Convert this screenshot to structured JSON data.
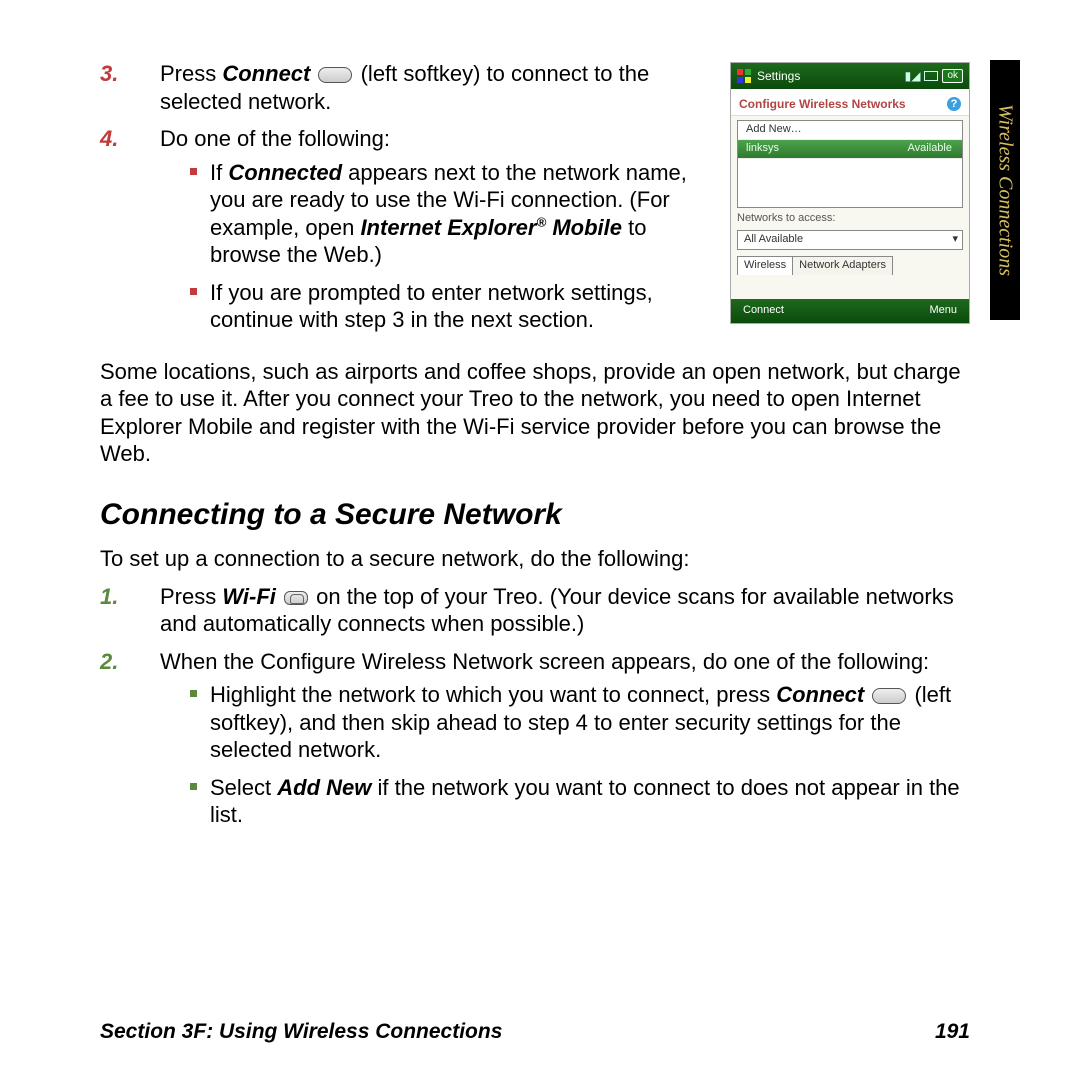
{
  "side_tab": "Wireless Connections",
  "step3": {
    "num": "3.",
    "pre": "Press ",
    "connect": "Connect",
    "post": " (left softkey) to connect to the selected network."
  },
  "step4": {
    "num": "4.",
    "text": "Do one of the following:",
    "bullets": {
      "b1": {
        "a": "If ",
        "b": "Connected",
        "c": " appears next to the network name, you are ready to use the Wi-Fi connection. (For example, open ",
        "d": "Internet Explorer",
        "reg": "®",
        "e": " Mobile",
        "f": " to browse the Web.)"
      },
      "b2": "If you are prompted to enter network settings, continue with step 3 in the next section."
    }
  },
  "below_para": "Some locations, such as airports and coffee shops, provide an open network, but charge a fee to use it. After you connect your Treo to the network, you need to open Internet Explorer Mobile and register with the Wi-Fi service provider before you can browse the Web.",
  "heading": "Connecting to a Secure Network",
  "intro": "To set up a connection to a secure network, do the following:",
  "sec_step1": {
    "num": "1.",
    "a": "Press ",
    "b": "Wi-Fi",
    "c": " on the top of your Treo. (Your device scans for available networks and automatically connects when possible.)"
  },
  "sec_step2": {
    "num": "2.",
    "text": "When the Configure Wireless Network screen appears, do one of the following:",
    "bullets": {
      "b1": {
        "a": "Highlight the network to which you want to connect, press ",
        "b": "Connect",
        "c": " (left softkey), and then skip ahead to step 4 to enter security settings for the selected network."
      },
      "b2": {
        "a": "Select ",
        "b": "Add New",
        "c": " if the network you want to connect to does not appear in the list."
      }
    }
  },
  "shot": {
    "title": "Settings",
    "ok": "ok",
    "subbar": "Configure Wireless Networks",
    "add_new": "Add New…",
    "network": "linksys",
    "status": "Available",
    "label_access": "Networks to access:",
    "combo_value": "All Available",
    "tab1": "Wireless",
    "tab2": "Network Adapters",
    "soft_left": "Connect",
    "soft_right": "Menu"
  },
  "footer": {
    "left": "Section 3F: Using Wireless Connections",
    "right": "191"
  }
}
